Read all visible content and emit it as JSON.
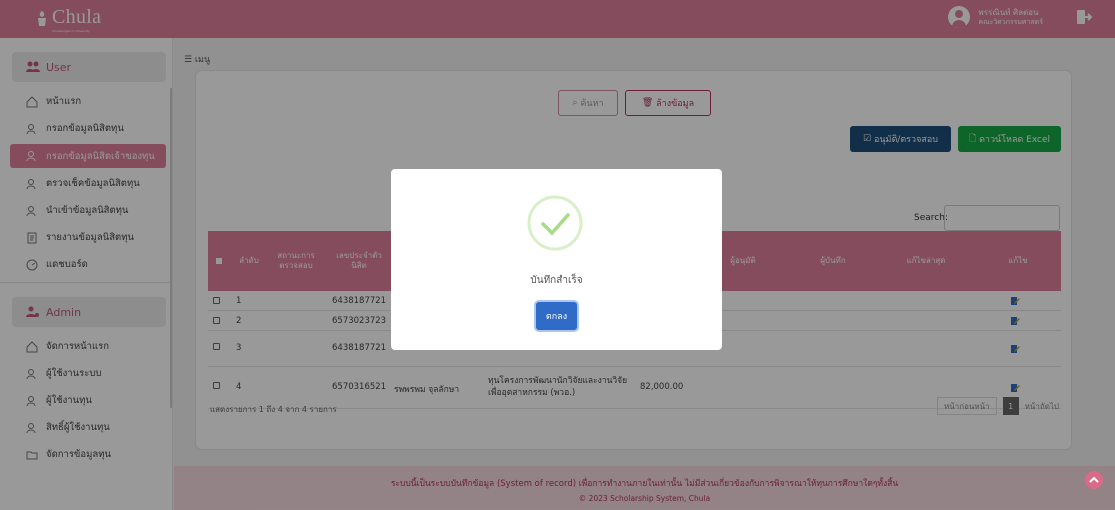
{
  "header": {
    "logo_text": "Chula",
    "logo_sub": "Chulalongkorn University",
    "user_name": "พรรณินท์ ศิลต่อน",
    "user_faculty": "คณะวิศวกรรมศาสตร์"
  },
  "sidebar": {
    "user_section": "User",
    "user_items": [
      {
        "label": "หน้าแรก"
      },
      {
        "label": "กรอกข้อมูลนิสิตทุน"
      },
      {
        "label": "กรอกข้อมูลนิสิตเจ้าของทุน"
      },
      {
        "label": "ตรวจเช็คข้อมูลนิสิตทุน"
      },
      {
        "label": "นำเข้าข้อมูลนิสิตทุน"
      },
      {
        "label": "รายงานข้อมูลนิสิตทุน"
      },
      {
        "label": "แดชบอร์ด"
      }
    ],
    "admin_section": "Admin",
    "admin_items": [
      {
        "label": "จัดการหน้าแรก"
      },
      {
        "label": "ผู้ใช้งานระบบ"
      },
      {
        "label": "ผู้ใช้งานทุน"
      },
      {
        "label": "สิทธิ์ผู้ใช้งานทุน"
      },
      {
        "label": "จัดการข้อมูลทุน"
      }
    ]
  },
  "main": {
    "menu_label": "☰ เมนู",
    "search_button": "ค้นหา",
    "clear_button": "ล้างข้อมูล",
    "approve_button": "อนุมัติ/ตรวจสอบ",
    "excel_button": "ดาวน์โหลด Excel",
    "search_label": "Search:",
    "table": {
      "headers": [
        "ลำดับ",
        "สถานะการตรวจสอบ",
        "เลขประจำตัวนิสิต",
        "ผู้อนุมัติ",
        "ผู้บันทึก",
        "แก้ไขล่าสุด",
        "แก้ไข"
      ],
      "rows": [
        {
          "no": "1",
          "student_id": "6438187721",
          "name": "",
          "scholarship": "",
          "amount": ""
        },
        {
          "no": "2",
          "student_id": "6573023723",
          "name": "",
          "scholarship": "",
          "amount": ""
        },
        {
          "no": "3",
          "student_id": "6438187721",
          "name": "",
          "scholarship": "",
          "amount": ""
        },
        {
          "no": "4",
          "student_id": "6570316521",
          "name": "รพพรพม จุลลักษา",
          "scholarship": "ทุนโครงการพัฒนานักวิจัยและงานวิจัยเพื่ออุตสาหกรรม (พวอ.)",
          "amount": "82,000.00"
        }
      ]
    },
    "showing_text": "แสดงรายการ 1 ถึง 4 จาก 4 รายการ",
    "pager": {
      "prev": "หน้าก่อนหน้า",
      "current": "1",
      "next": "หน้าถัดไป"
    }
  },
  "footer": {
    "disclaimer": "ระบบนี้เป็นระบบบันทึกข้อมูล (System of record) เพื่อการทำงานภายในเท่านั้น ไม่มีส่วนเกี่ยวข้องกับการพิจารณาให้ทุนการศึกษาใดๆทั้งสิ้น",
    "copyright": "© 2023 Scholarship System, Chula"
  },
  "modal": {
    "message": "บันทึกสำเร็จ",
    "ok_button": "ตกลง"
  },
  "colors": {
    "brand": "#dd7f9a",
    "accent": "#c0587a",
    "approve": "#1e4f7a",
    "excel": "#18a846",
    "ok": "#2f6bc7",
    "success": "#a5dc86"
  }
}
